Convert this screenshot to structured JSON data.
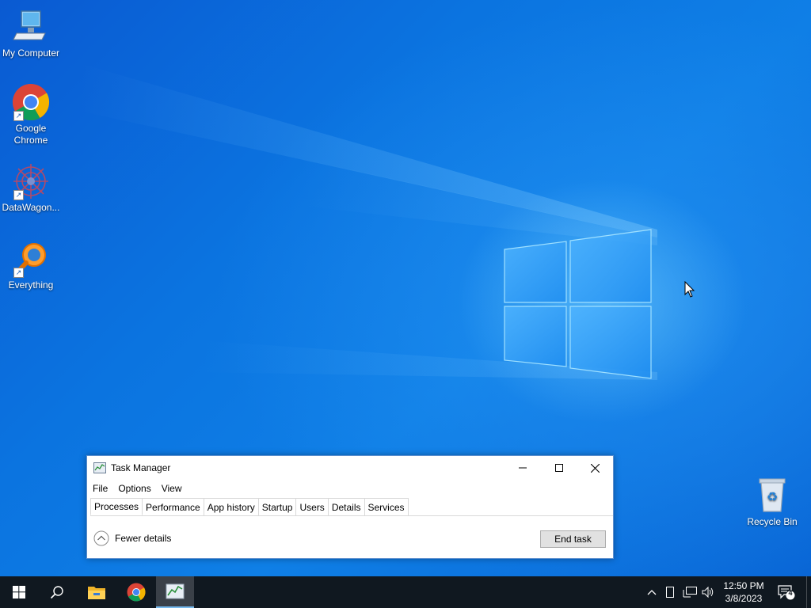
{
  "desktop": {
    "icons": [
      {
        "label": "My Computer",
        "icon": "computer-icon"
      },
      {
        "label": "Google Chrome",
        "label_line1": "Google",
        "label_line2": "Chrome",
        "icon": "chrome-icon"
      },
      {
        "label": "DataWagon...",
        "icon": "datawagon-icon"
      },
      {
        "label": "Everything",
        "icon": "everything-search-icon"
      },
      {
        "label": "Recycle Bin",
        "icon": "recycle-bin-icon"
      }
    ]
  },
  "task_manager": {
    "title": "Task Manager",
    "menu": [
      "File",
      "Options",
      "View"
    ],
    "tabs": [
      "Processes",
      "Performance",
      "App history",
      "Startup",
      "Users",
      "Details",
      "Services"
    ],
    "active_tab": "Processes",
    "fewer_details_label": "Fewer details",
    "end_task_label": "End task"
  },
  "taskbar": {
    "pinned": [
      "start-icon",
      "search-icon",
      "file-explorer-icon",
      "chrome-icon",
      "task-manager-icon"
    ],
    "clock_time": "12:50 PM",
    "clock_date": "3/8/2023",
    "notification_count": "4"
  },
  "colors": {
    "taskbar_bg": "#101820",
    "window_border": "#5d8fce",
    "accent": "#76b9ed"
  }
}
